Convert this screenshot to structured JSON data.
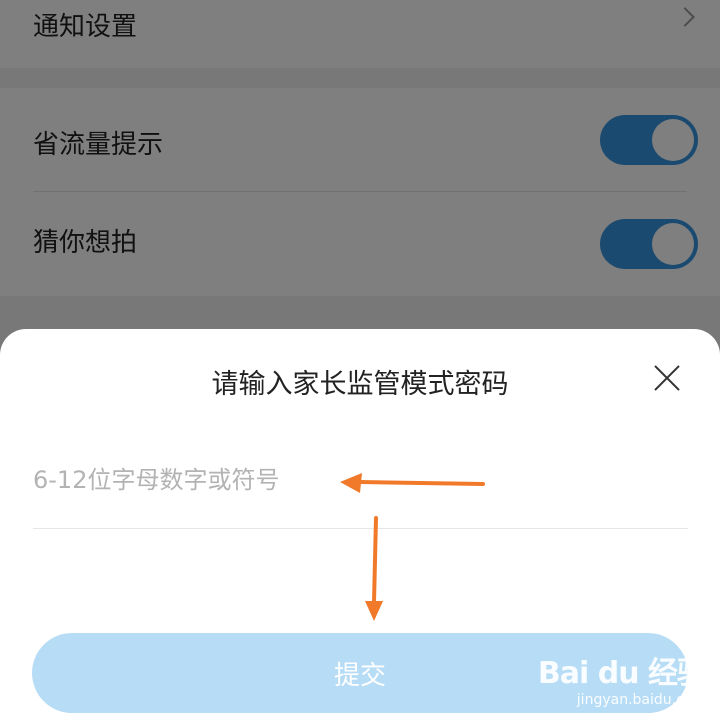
{
  "settings": {
    "notify": {
      "label": "通知设置"
    },
    "save_data": {
      "label": "省流量提示",
      "enabled": true
    },
    "guess": {
      "label": "猜你想拍",
      "enabled": true
    }
  },
  "dialog": {
    "title": "请输入家长监管模式密码",
    "input_placeholder": "6-12位字母数字或符号",
    "input_value": "",
    "submit_label": "提交"
  },
  "watermark": {
    "logo": "Bai du 经验",
    "url": "jingyan.baidu.com"
  },
  "colors": {
    "toggle_on": "#3794e0",
    "submit_bg": "#b7dcf6",
    "annotation_arrow": "#f07a2a"
  }
}
